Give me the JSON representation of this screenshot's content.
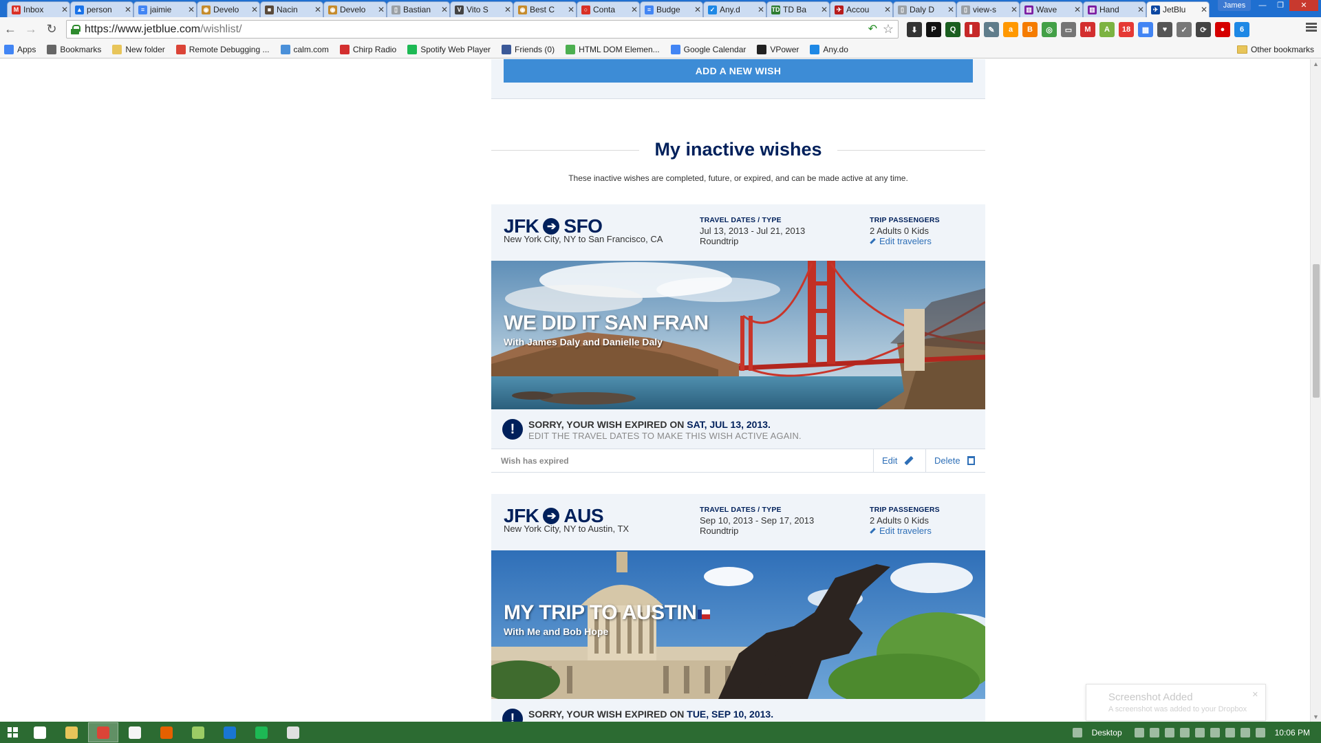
{
  "browser": {
    "tabs": [
      {
        "title": "Inbox",
        "color": "#d93025",
        "glyph": "M"
      },
      {
        "title": "person",
        "color": "#1a73e8",
        "glyph": "▲"
      },
      {
        "title": "jaimie",
        "color": "#4285f4",
        "glyph": "≡"
      },
      {
        "title": "Develo",
        "color": "#c58b2c",
        "glyph": "◉"
      },
      {
        "title": "Nacin",
        "color": "#5a4a3a",
        "glyph": "■"
      },
      {
        "title": "Develo",
        "color": "#c58b2c",
        "glyph": "◉"
      },
      {
        "title": "Bastian",
        "color": "#9aa0a6",
        "glyph": "▯"
      },
      {
        "title": "Vito S",
        "color": "#444444",
        "glyph": "V"
      },
      {
        "title": "Best C",
        "color": "#c58b2c",
        "glyph": "◉"
      },
      {
        "title": "Conta",
        "color": "#d93025",
        "glyph": "○"
      },
      {
        "title": "Budge",
        "color": "#4285f4",
        "glyph": "≡"
      },
      {
        "title": "Any.d",
        "color": "#1e88e5",
        "glyph": "✓"
      },
      {
        "title": "TD Ba",
        "color": "#2e7d32",
        "glyph": "TD"
      },
      {
        "title": "Accou",
        "color": "#b71c1c",
        "glyph": "✈"
      },
      {
        "title": "Daly D",
        "color": "#9aa0a6",
        "glyph": "▯"
      },
      {
        "title": "view-s",
        "color": "#9aa0a6",
        "glyph": "▯"
      },
      {
        "title": "Wave",
        "color": "#7b1fa2",
        "glyph": "▥"
      },
      {
        "title": "Hand",
        "color": "#7b1fa2",
        "glyph": "▥"
      },
      {
        "title": "JetBlu",
        "color": "#0d47a1",
        "glyph": "✈",
        "active": true
      }
    ],
    "profile_name": "James",
    "url_main": "https://www.jetblue.com",
    "url_path": "/wishlist/",
    "bookmarks": [
      {
        "label": "Apps",
        "icon": "apps-icon",
        "color": "#4285f4"
      },
      {
        "label": "Bookmarks",
        "icon": "star-icon",
        "color": "#666666"
      },
      {
        "label": "New folder",
        "icon": "folder-icon",
        "color": "#e8c55a"
      },
      {
        "label": "Remote Debugging ...",
        "icon": "chrome-icon",
        "color": "#db4437"
      },
      {
        "label": "calm.com",
        "icon": "calm-icon",
        "color": "#4a90d9"
      },
      {
        "label": "Chirp Radio",
        "icon": "chirp-icon",
        "color": "#d32f2f"
      },
      {
        "label": "Spotify Web Player",
        "icon": "spotify-icon",
        "color": "#1db954"
      },
      {
        "label": "Friends (0)",
        "icon": "facebook-icon",
        "color": "#3b5998"
      },
      {
        "label": "HTML DOM Elemen...",
        "icon": "w3-icon",
        "color": "#4caf50"
      },
      {
        "label": "Google Calendar",
        "icon": "calendar-icon",
        "color": "#4285f4"
      },
      {
        "label": "VPower",
        "icon": "vpower-icon",
        "color": "#222222"
      },
      {
        "label": "Any.do",
        "icon": "anydo-icon",
        "color": "#1e88e5"
      }
    ],
    "other_bookmarks": "Other bookmarks"
  },
  "page": {
    "add_wish_label": "ADD A NEW WISH",
    "section_title": "My inactive wishes",
    "section_subtitle": "These inactive wishes are completed, future, or expired, and can be made active at any time.",
    "wishes": [
      {
        "origin": "JFK",
        "destination": "SFO",
        "route_desc": "New York City, NY to San Francisco, CA",
        "dates_label": "TRAVEL DATES / TYPE",
        "dates": "Jul 13, 2013 - Jul 21, 2013",
        "trip_type": "Roundtrip",
        "passengers_label": "TRIP PASSENGERS",
        "passengers": "2 Adults 0 Kids",
        "edit_travelers": "Edit travelers",
        "image_title": "WE DID IT SAN FRAN",
        "image_subtitle": "With James Daly and Danielle Daly",
        "expired_prefix": "SORRY, YOUR WISH EXPIRED ON",
        "expired_date": "SAT, JUL 13, 2013.",
        "expired_hint": "EDIT THE TRAVEL DATES TO MAKE THIS WISH ACTIVE AGAIN.",
        "status": "Wish has expired",
        "edit_label": "Edit",
        "delete_label": "Delete"
      },
      {
        "origin": "JFK",
        "destination": "AUS",
        "route_desc": "New York City, NY to Austin, TX",
        "dates_label": "TRAVEL DATES / TYPE",
        "dates": "Sep 10, 2013 - Sep 17, 2013",
        "trip_type": "Roundtrip",
        "passengers_label": "TRIP PASSENGERS",
        "passengers": "2 Adults 0 Kids",
        "edit_travelers": "Edit travelers",
        "image_title": "MY TRIP TO AUSTIN",
        "image_subtitle": "With Me and Bob Hope",
        "expired_prefix": "SORRY, YOUR WISH EXPIRED ON",
        "expired_date": "TUE, SEP 10, 2013."
      }
    ]
  },
  "toast": {
    "title": "Screenshot Added",
    "body": "A screenshot was added to your Dropbox"
  },
  "taskbar": {
    "desktop_label": "Desktop",
    "time": "10:06 PM",
    "apps": [
      {
        "name": "home-icon",
        "color": "#ffffff"
      },
      {
        "name": "explorer-icon",
        "color": "#e8c55a"
      },
      {
        "name": "chrome-icon",
        "color": "#db4437",
        "active": true
      },
      {
        "name": "calculator-icon",
        "color": "#f5f5f5"
      },
      {
        "name": "firefox-icon",
        "color": "#e66000"
      },
      {
        "name": "notepad-icon",
        "color": "#9ccc65"
      },
      {
        "name": "1password-icon",
        "color": "#1976d2"
      },
      {
        "name": "spotify-icon",
        "color": "#1db954"
      },
      {
        "name": "document-icon",
        "color": "#e0e0e0"
      }
    ]
  }
}
